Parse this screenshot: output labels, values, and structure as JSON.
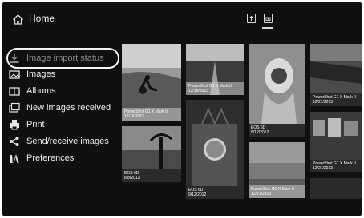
{
  "header": {
    "title": "Home",
    "icons": [
      "export-icon",
      "camera-card-icon"
    ]
  },
  "menu": {
    "items": [
      {
        "label": "Image import status",
        "icon": "import-status-icon",
        "selected": true
      },
      {
        "label": "Images",
        "icon": "images-icon"
      },
      {
        "label": "Albums",
        "icon": "albums-icon"
      },
      {
        "label": "New images received",
        "icon": "new-images-icon"
      },
      {
        "label": "Print",
        "icon": "printer-icon"
      },
      {
        "label": "Send/receive images",
        "icon": "share-icon"
      },
      {
        "label": "Preferences",
        "icon": "preferences-icon"
      }
    ]
  },
  "thumbnails": [
    {
      "camera": "PowerShot G1 X Mark II",
      "date": "12/16/2013"
    },
    {
      "camera": "PowerShot G1 X Mark II",
      "date": "12/18/2013"
    },
    {
      "camera": "PowerShot G1 X Mark II",
      "date": "12/21/2013"
    },
    {
      "camera": "EOS 6D",
      "date": "8/8/2012"
    },
    {
      "camera": "EOS 6D",
      "date": "9/12/2012"
    },
    {
      "camera": "EOS 6D",
      "date": "8/12/2012"
    },
    {
      "camera": "PowerShot G1 X Mark II",
      "date": "12/21/2013"
    },
    {
      "camera": "PowerShot G1 X Mark II",
      "date": "12/21/2013"
    }
  ]
}
